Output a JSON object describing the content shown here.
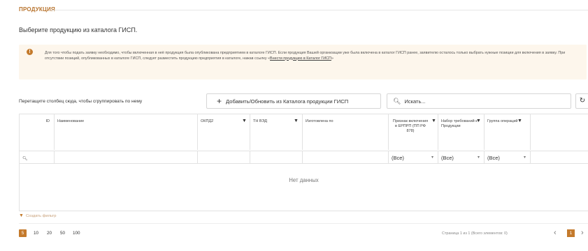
{
  "section": {
    "title": "ПРОДУКЦИЯ"
  },
  "subtitle": "Выберите продукцию из каталога ГИСП.",
  "notice": {
    "text": "Для того чтобы подать заявку необходимо, чтобы включенная в неё продукция была опубликована предприятием в каталоге ГИСП. Если продукция Вашей организации уже была включена в каталог ГИСП ранее, заявителю осталось только выбрать нужные позиции для включения в заявку. При отсутствии позиций, опубликованных в каталоге ГИСП, следует разместить продукцию предприятия в каталоге, нажав ссылку «",
    "link": "Внести продукцию в Каталог ГИСП",
    "tail": "»"
  },
  "toolbar": {
    "group_hint": "Перетащите столбец сюда, чтобы сгруппировать по нему",
    "add_button": "Добавить/Обновить из Каталога продукции ГИСП",
    "search_placeholder": "Искать..."
  },
  "table": {
    "columns": [
      {
        "label": "ID",
        "filterable": false
      },
      {
        "label": "Наименование",
        "filterable": false
      },
      {
        "label": "ОКПД2",
        "filterable": true
      },
      {
        "label": "ТН ВЭД",
        "filterable": true
      },
      {
        "label": "Изготовлена по",
        "filterable": false
      },
      {
        "label": "Признак включения в ЕРПРП (ПП РФ 878)",
        "filterable": true
      },
      {
        "label": "Набор требований к Продукции",
        "filterable": true
      },
      {
        "label": "Группа операций",
        "filterable": true
      }
    ],
    "filter_values": [
      "(Все)",
      "(Все)",
      "(Все)"
    ],
    "no_data": "Нет данных"
  },
  "create_filter": "Создать фильтр",
  "pager": {
    "sizes": [
      "5",
      "10",
      "20",
      "50",
      "100"
    ],
    "info": "Страница 1 из 1 (Всего элементов: 0)",
    "current": "1"
  },
  "colors": {
    "accent": "#c47a2c",
    "notice_bg": "#fdf6ec"
  }
}
